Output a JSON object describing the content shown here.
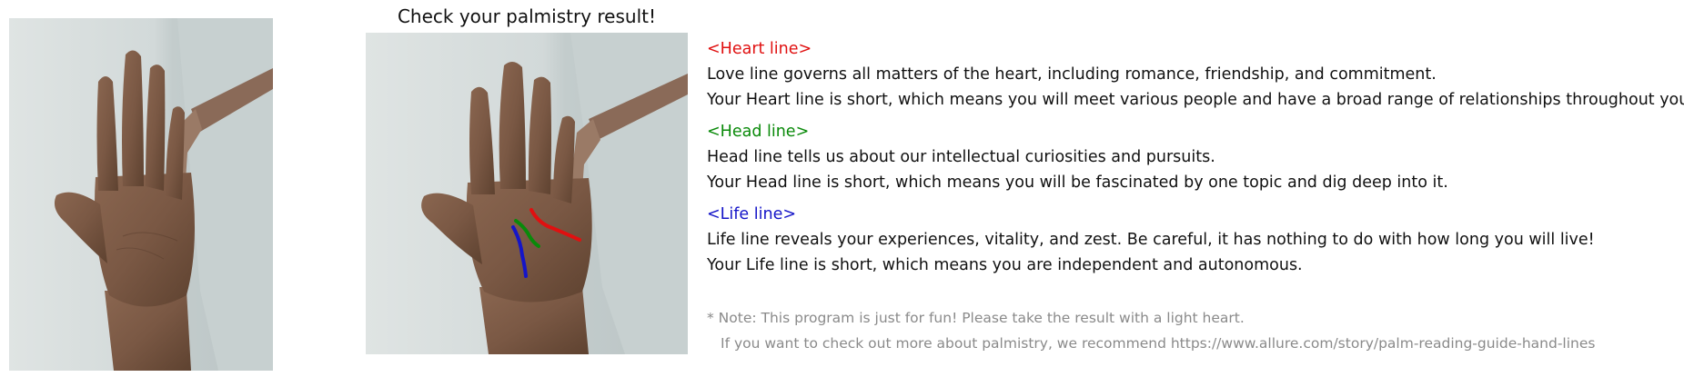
{
  "result": {
    "title": "Check your palmistry result!"
  },
  "lines": [
    {
      "header": "<Heart line>",
      "color": "#e01010",
      "description": "Love line governs all matters of the heart, including romance, friendship, and commitment.",
      "result": "Your Heart line is short, which means you will meet various people and have a broad range of relationships throughout your life."
    },
    {
      "header": "<Head line>",
      "color": "#0a8a0a",
      "description": "Head line tells us about our intellectual curiosities and pursuits.",
      "result": "Your Head line is short, which means you will be fascinated by one topic and dig deep into it."
    },
    {
      "header": "<Life line>",
      "color": "#1515c8",
      "description": "Life line reveals your experiences, vitality, and zest. Be careful, it has nothing to do with how long you will live!",
      "result": "Your Life line is short, which means you are independent and autonomous."
    }
  ],
  "note": {
    "line1": "* Note: This program is just for fun! Please take the result with a light heart.",
    "line2": "If you want to check out more about palmistry, we recommend https://www.allure.com/story/palm-reading-guide-hand-lines"
  },
  "colors": {
    "note_text": "#8a8a8a",
    "body_text": "#111111"
  }
}
